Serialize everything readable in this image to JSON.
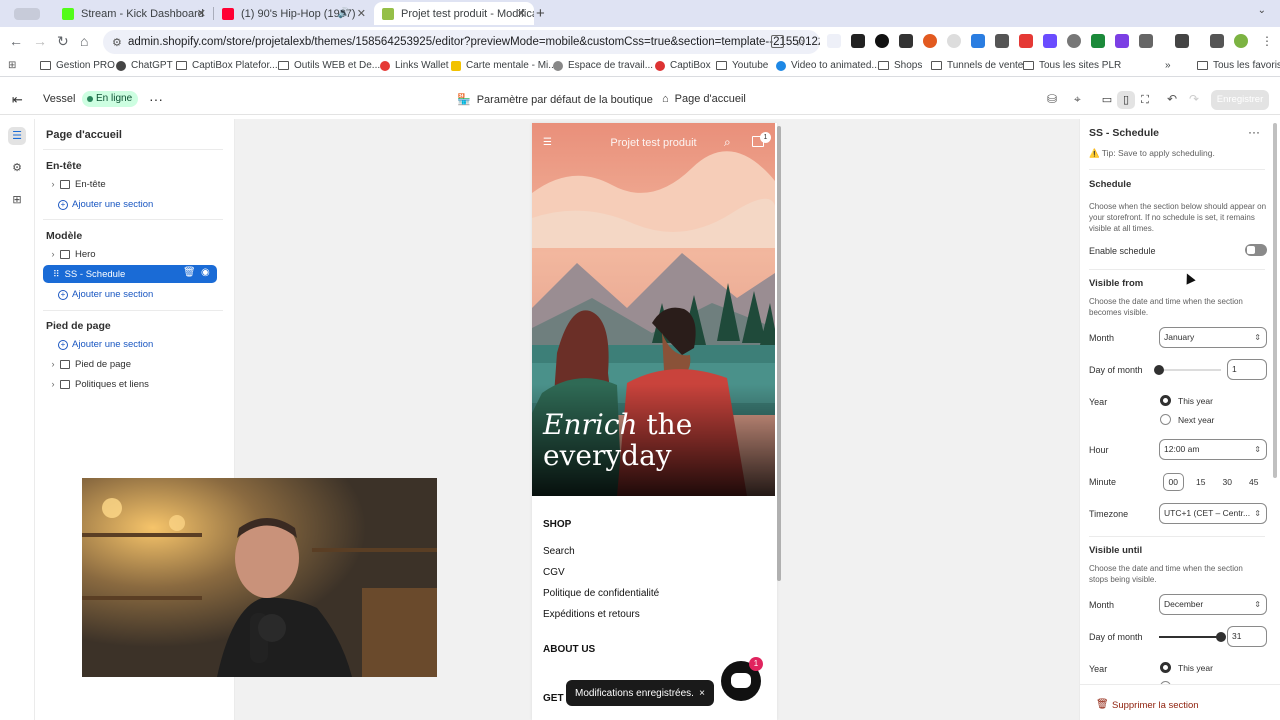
{
  "browser": {
    "tabs": [
      {
        "title": "Stream - Kick Dashboard",
        "color": "#53fc18"
      },
      {
        "title": "(1) 90's Hip-Hop (1997)",
        "color": "#ff0033"
      },
      {
        "title": "Projet test produit - Modificat",
        "color": "#95bf47"
      }
    ],
    "url": "admin.shopify.com/store/projetalexb/themes/158564253925/editor?previewMode=mobile&customCss=true&section=template--21550122631...",
    "bookmarks": [
      "Gestion PRO",
      "ChatGPT",
      "CaptiBox Platefor...",
      "Outils WEB et De...",
      "Links Wallet",
      "Carte mentale - Mi...",
      "Espace de travail...",
      "CaptiBox",
      "Youtube",
      "Video to animated...",
      "Shops",
      "Tunnels de vente",
      "Tous les sites PLR"
    ],
    "all_bookmarks": "Tous les favoris"
  },
  "editor": {
    "theme_name": "Vessel",
    "status": "En ligne",
    "default_store": "Paramètre par défaut de la boutique",
    "page": "Page d'accueil",
    "save_label": "Enregistrer"
  },
  "sidebar": {
    "title": "Page d'accueil",
    "header_group": "En-tête",
    "header_item": "En-tête",
    "add_section": "Ajouter une section",
    "template_group": "Modèle",
    "template_items": [
      "Hero",
      "SS - Schedule"
    ],
    "footer_group": "Pied de page",
    "footer_items": [
      "Pied de page",
      "Politiques et liens"
    ]
  },
  "preview": {
    "store_name": "Projet test produit",
    "cart_count": "1",
    "hero_italic": "Enrich",
    "hero_rest": " the",
    "hero_line2": "everyday",
    "shop_heading": "SHOP",
    "shop_links": [
      "Search",
      "CGV",
      "Politique de confidentialité",
      "Expéditions et retours"
    ],
    "about_heading": "ABOUT US",
    "get_heading": "GET Y"
  },
  "toast": {
    "text": "Modifications enregistrées.",
    "close": "×"
  },
  "chat": {
    "count": "1"
  },
  "panel": {
    "title": "SS - Schedule",
    "tip": "⚠️ Tip: Save to apply scheduling.",
    "schedule_heading": "Schedule",
    "schedule_desc": "Choose when the section below should appear on your storefront. If no schedule is set, it remains visible at all times.",
    "enable_label": "Enable schedule",
    "from": {
      "heading": "Visible from",
      "desc": "Choose the date and time when the section becomes visible.",
      "month_label": "Month",
      "month": "January",
      "day_label": "Day of month",
      "day": "1",
      "day_fraction": 0,
      "year_label": "Year",
      "year_options": [
        "This year",
        "Next year"
      ],
      "hour_label": "Hour",
      "hour": "12:00 am",
      "minute_label": "Minute",
      "minutes": [
        "00",
        "15",
        "30",
        "45"
      ],
      "timezone_label": "Timezone",
      "timezone": "UTC+1 (CET – Centr..."
    },
    "until": {
      "heading": "Visible until",
      "desc": "Choose the date and time when the section stops being visible.",
      "month_label": "Month",
      "month": "December",
      "day_label": "Day of month",
      "day": "31",
      "day_fraction": 1,
      "year_label": "Year",
      "year_options": [
        "This year",
        "Next year"
      ]
    },
    "delete_label": "Supprimer la section"
  }
}
